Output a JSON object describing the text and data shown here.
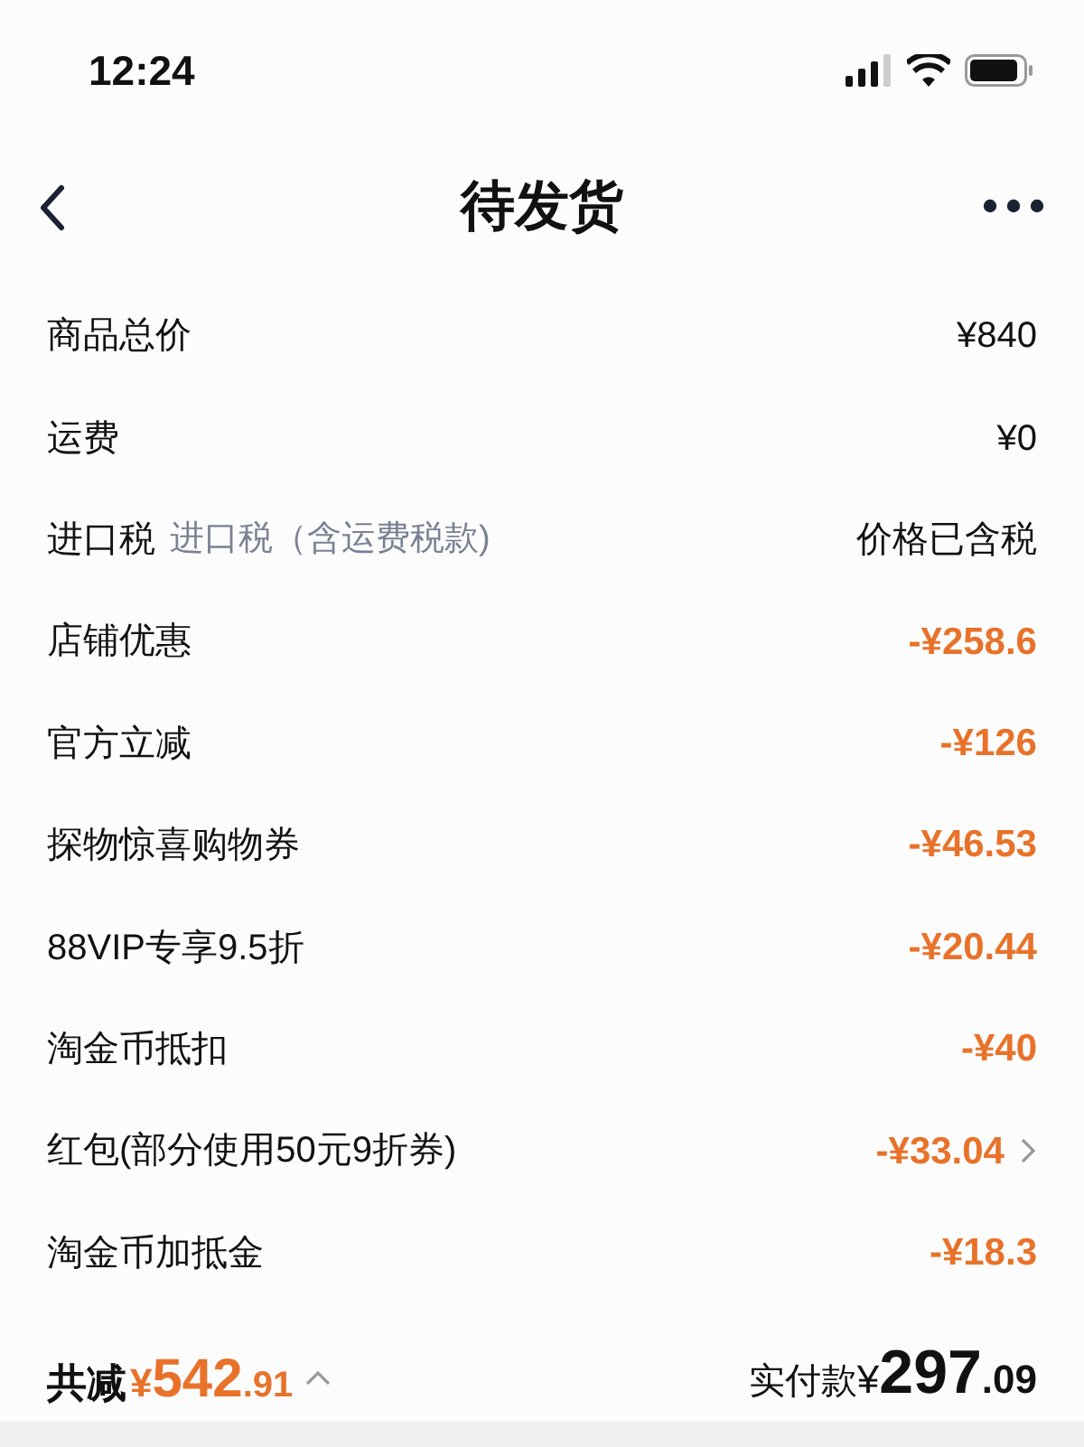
{
  "status_bar": {
    "time": "12:24"
  },
  "nav": {
    "title": "待发货"
  },
  "rows": [
    {
      "label": "商品总价",
      "value": "¥840",
      "kind": "price"
    },
    {
      "label": "运费",
      "value": "¥0",
      "kind": "price"
    },
    {
      "label": "进口税",
      "note": "进口税（含运费税款)",
      "value": "价格已含税",
      "kind": "price"
    },
    {
      "label": "店铺优惠",
      "value": "-¥258.6",
      "kind": "discount"
    },
    {
      "label": "官方立减",
      "value": "-¥126",
      "kind": "discount"
    },
    {
      "label": "探物惊喜购物券",
      "value": "-¥46.53",
      "kind": "discount"
    },
    {
      "label": "88VIP专享9.5折",
      "value": "-¥20.44",
      "kind": "discount"
    },
    {
      "label": "淘金币抵扣",
      "value": "-¥40",
      "kind": "discount"
    },
    {
      "label": "红包(部分使用50元9折券)",
      "value": "-¥33.04",
      "kind": "discount",
      "has_arrow": true
    },
    {
      "label": "淘金币加抵金",
      "value": "-¥18.3",
      "kind": "discount"
    }
  ],
  "footer": {
    "saved_label": "共减",
    "saved_currency": "¥",
    "saved_integer": "542",
    "saved_decimal": ".91",
    "expanded": true,
    "paid_label": "实付款",
    "paid_currency": "¥",
    "paid_integer": "297",
    "paid_decimal": ".09"
  }
}
